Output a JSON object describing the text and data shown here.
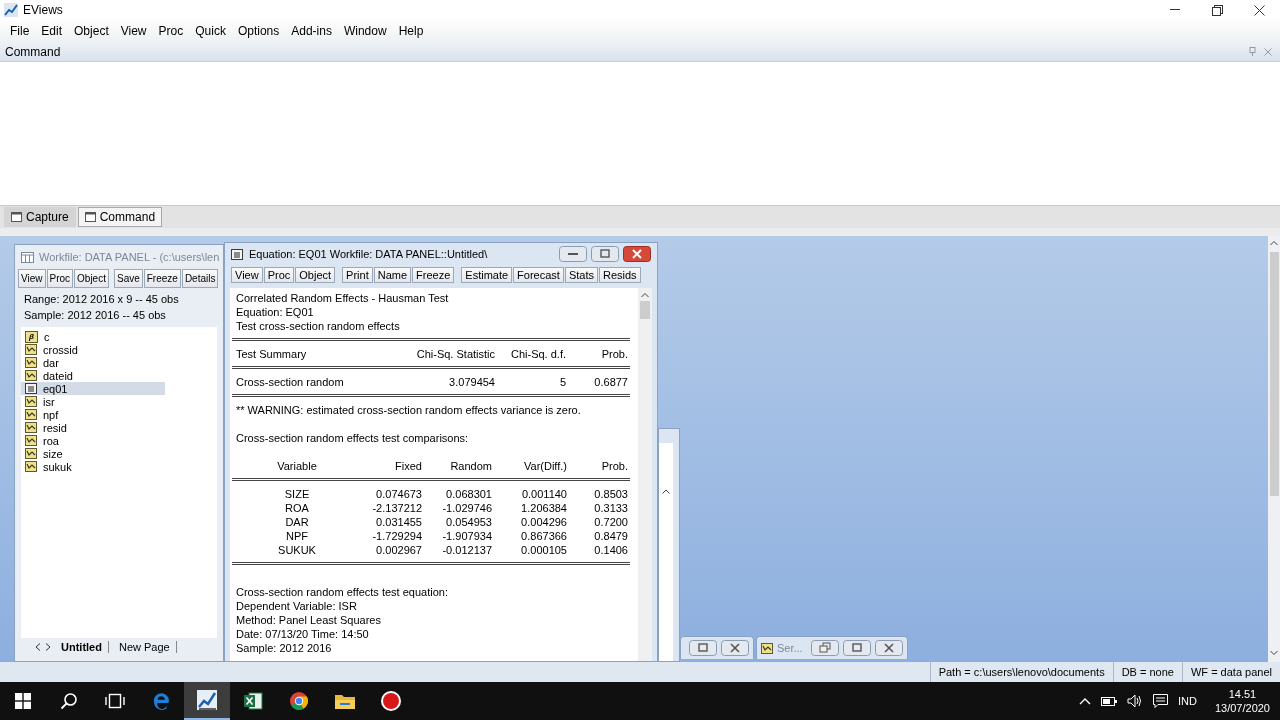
{
  "app": {
    "title": "EViews"
  },
  "menu": [
    "File",
    "Edit",
    "Object",
    "View",
    "Proc",
    "Quick",
    "Options",
    "Add-ins",
    "Window",
    "Help"
  ],
  "command_pane": {
    "title": "Command"
  },
  "pane_tabs": [
    {
      "label": "Capture",
      "selected": false
    },
    {
      "label": "Command",
      "selected": true
    }
  ],
  "workfile": {
    "title": "Workfile: DATA PANEL - (c:\\users\\len",
    "toolbar": [
      "View",
      "Proc",
      "Object",
      "Save",
      "Freeze",
      "Details"
    ],
    "range": "Range:  2012 2016 x 9  --  45 obs",
    "sample": "Sample: 2012 2016  --  45 obs",
    "objects": [
      {
        "name": "c",
        "kind": "coef",
        "badge": "β",
        "selected": false
      },
      {
        "name": "crossid",
        "kind": "series",
        "selected": false
      },
      {
        "name": "dar",
        "kind": "series",
        "selected": false
      },
      {
        "name": "dateid",
        "kind": "series",
        "selected": false
      },
      {
        "name": "eq01",
        "kind": "equation",
        "selected": true
      },
      {
        "name": "isr",
        "kind": "series",
        "selected": false
      },
      {
        "name": "npf",
        "kind": "series",
        "selected": false
      },
      {
        "name": "resid",
        "kind": "series",
        "selected": false
      },
      {
        "name": "roa",
        "kind": "series",
        "selected": false
      },
      {
        "name": "size",
        "kind": "series",
        "selected": false
      },
      {
        "name": "sukuk",
        "kind": "series",
        "selected": false
      }
    ],
    "page_tabs": [
      {
        "label": "Untitled",
        "selected": true
      },
      {
        "label": "New Page",
        "selected": false
      }
    ]
  },
  "equation": {
    "title": "Equation: EQ01   Workfile: DATA PANEL::Untitled\\",
    "toolbar": [
      "View",
      "Proc",
      "Object",
      "Print",
      "Name",
      "Freeze",
      "Estimate",
      "Forecast",
      "Stats",
      "Resids"
    ],
    "header": [
      "Correlated Random Effects - Hausman Test",
      "Equation: EQ01",
      "Test cross-section random effects"
    ],
    "summary": {
      "columns": [
        "Test Summary",
        "Chi-Sq. Statistic",
        "Chi-Sq. d.f.",
        "Prob."
      ],
      "row": [
        "Cross-section random",
        "3.079454",
        "5",
        "0.6877"
      ]
    },
    "warning": "** WARNING: estimated cross-section random effects variance is zero.",
    "comparisons_title": "Cross-section random effects test comparisons:",
    "comparisons": {
      "columns": [
        "Variable",
        "Fixed",
        "Random",
        "Var(Diff.)",
        "Prob."
      ],
      "rows": [
        [
          "SIZE",
          "0.074673",
          "0.068301",
          "0.001140",
          "0.8503"
        ],
        [
          "ROA",
          "-2.137212",
          "-1.029746",
          "1.206384",
          "0.3133"
        ],
        [
          "DAR",
          "0.031455",
          "0.054953",
          "0.004296",
          "0.7200"
        ],
        [
          "NPF",
          "-1.729294",
          "-1.907934",
          "0.867366",
          "0.8479"
        ],
        [
          "SUKUK",
          "0.002967",
          "-0.012137",
          "0.000105",
          "0.1406"
        ]
      ]
    },
    "equation_lines": [
      "Cross-section random effects test equation:",
      "Dependent Variable: ISR",
      "Method: Panel Least Squares",
      "Date: 07/13/20   Time: 14:50",
      "Sample: 2012 2016"
    ]
  },
  "minimized": [
    {
      "title": "Ser..."
    }
  ],
  "status_bar": [
    "Path = c:\\users\\lenovo\\documents",
    "DB = none",
    "WF = data panel"
  ],
  "taskbar": {
    "buttons": [
      {
        "kind": "start",
        "selected": false
      },
      {
        "kind": "search",
        "selected": false
      },
      {
        "kind": "task-view",
        "selected": false
      },
      {
        "kind": "browser",
        "selected": false
      },
      {
        "kind": "eviews",
        "selected": true
      },
      {
        "kind": "spreadsheet",
        "selected": false
      },
      {
        "kind": "chrome",
        "selected": false
      },
      {
        "kind": "folder",
        "selected": false
      },
      {
        "kind": "recorder",
        "selected": false
      }
    ],
    "language": "IND",
    "time": "14.51",
    "date": "13/07/2020"
  }
}
